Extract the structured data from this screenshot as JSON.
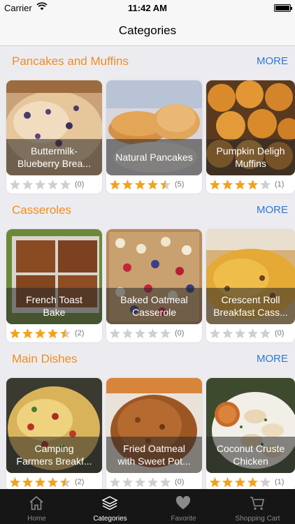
{
  "status_bar": {
    "carrier": "Carrier",
    "time": "11:42 AM"
  },
  "nav": {
    "title": "Categories"
  },
  "colors": {
    "section_title": "#f08c1e",
    "more_link": "#2a78d6",
    "star_on": "#f4a21c",
    "star_off": "#cfcfcf",
    "tab_bar": "#161616"
  },
  "sections": [
    {
      "title": "Pancakes and Muffins",
      "more": "MORE",
      "cards": [
        {
          "title": "Buttermilk-\nBlueberry Brea...",
          "stars": 0,
          "count": "(0)"
        },
        {
          "title": "Natural Pancakes",
          "stars": 4.5,
          "count": "(5)"
        },
        {
          "title": "Pumpkin Deligh\nMuffins",
          "stars": 4,
          "count": "(1)"
        }
      ]
    },
    {
      "title": "Casseroles",
      "more": "MORE",
      "cards": [
        {
          "title": "French Toast\nBake",
          "stars": 4.5,
          "count": "(2)"
        },
        {
          "title": "Baked Oatmeal\nCasserole",
          "stars": 0,
          "count": "(0)"
        },
        {
          "title": "Crescent Roll\nBreakfast Cass...",
          "stars": 0,
          "count": "(0)"
        }
      ]
    },
    {
      "title": "Main Dishes",
      "more": "MORE",
      "cards": [
        {
          "title": "Camping\nFarmers Breakf...",
          "stars": 4.5,
          "count": "(2)"
        },
        {
          "title": "Fried Oatmeal\nwith Sweet Pot...",
          "stars": 0,
          "count": "(0)"
        },
        {
          "title": "Coconut Cruste\nChicken",
          "stars": 4,
          "count": "(1)"
        }
      ]
    }
  ],
  "tabs": [
    {
      "label": "Home",
      "icon": "home-icon",
      "active": false
    },
    {
      "label": "Categories",
      "icon": "layers-icon",
      "active": true
    },
    {
      "label": "Favorite",
      "icon": "heart-icon",
      "active": false
    },
    {
      "label": "Shopping Cart",
      "icon": "cart-icon",
      "active": false
    }
  ]
}
